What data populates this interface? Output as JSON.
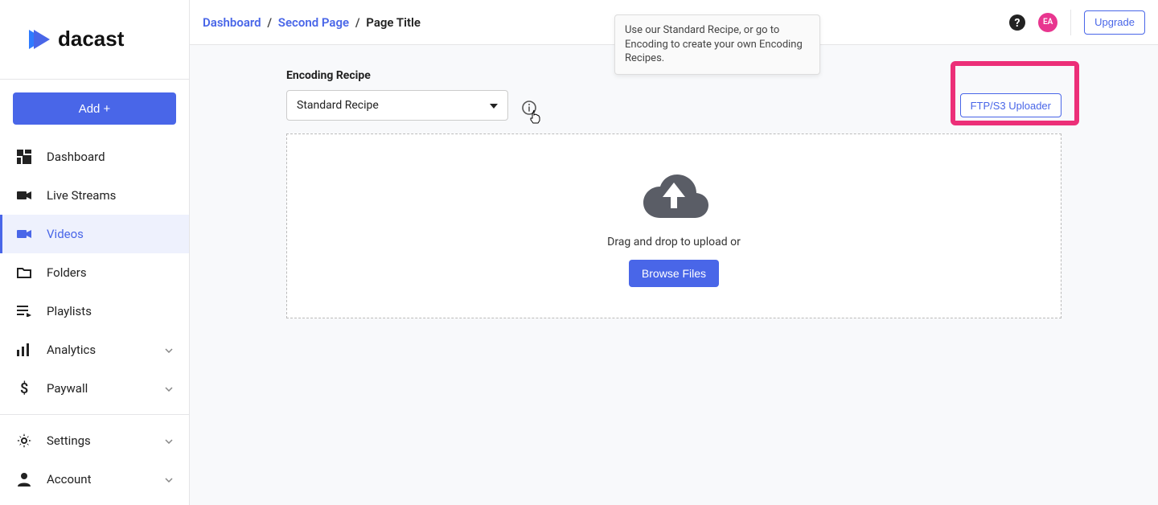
{
  "brand": "dacast",
  "sidebar": {
    "add_label": "Add +",
    "items": [
      {
        "label": "Dashboard",
        "icon": "dashboard-icon"
      },
      {
        "label": "Live Streams",
        "icon": "camera-icon"
      },
      {
        "label": "Videos",
        "icon": "video-icon"
      },
      {
        "label": "Folders",
        "icon": "folder-icon"
      },
      {
        "label": "Playlists",
        "icon": "playlist-icon"
      },
      {
        "label": "Analytics",
        "icon": "analytics-icon",
        "chevron": true
      },
      {
        "label": "Paywall",
        "icon": "dollar-icon",
        "chevron": true
      }
    ],
    "secondary": [
      {
        "label": "Settings",
        "icon": "gear-icon",
        "chevron": true
      },
      {
        "label": "Account",
        "icon": "person-icon",
        "chevron": true
      }
    ],
    "active_index": 2
  },
  "header": {
    "breadcrumb": {
      "root": "Dashboard",
      "second": "Second Page",
      "current": "Page Title",
      "sep": "/"
    },
    "avatar_initials": "EA",
    "upgrade_label": "Upgrade"
  },
  "encoding": {
    "label": "Encoding Recipe",
    "selected": "Standard Recipe",
    "tooltip": "Use our Standard Recipe, or go to Encoding to create your own Encoding Recipes.",
    "uploader_button": "FTP/S3 Uploader"
  },
  "dropzone": {
    "text": "Drag and drop to upload or",
    "button": "Browse Files"
  }
}
